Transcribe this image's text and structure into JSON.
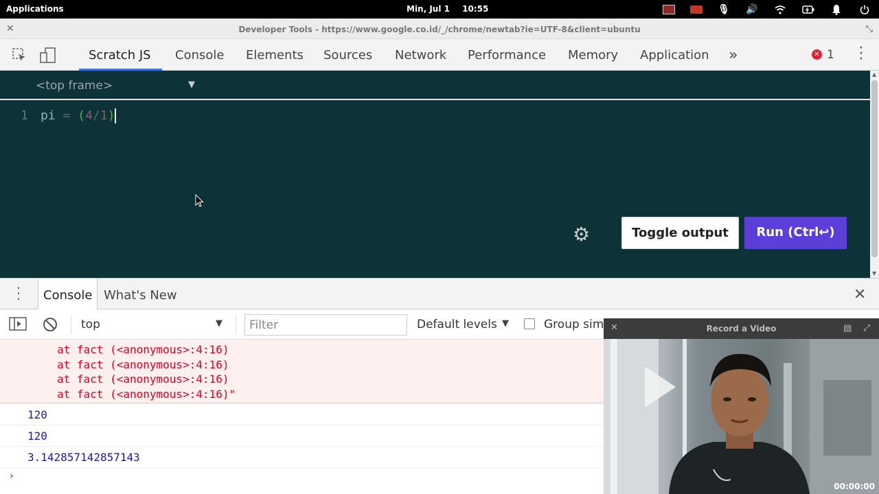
{
  "system_bar": {
    "applications": "Applications",
    "day_date": "Min, Jul 1",
    "time": "10:55"
  },
  "window": {
    "title": "Developer Tools - https://www.google.co.id/_/chrome/newtab?ie=UTF-8&client=ubuntu"
  },
  "devtools_tabs": [
    "Scratch JS",
    "Console",
    "Elements",
    "Sources",
    "Network",
    "Performance",
    "Memory",
    "Application"
  ],
  "more_tabs": "»",
  "error_badge": {
    "icon": "✕",
    "count": "1"
  },
  "editor": {
    "frame_selector": "<top frame>",
    "line_number": "1",
    "code": {
      "ident": "pi",
      "assign": "=",
      "open": "(",
      "num1": "4",
      "div": "/",
      "num2": "1",
      "close": ")"
    },
    "toggle_output": "Toggle output",
    "run": "Run (Ctrl↩)"
  },
  "drawer_tabs": {
    "console": "Console",
    "whats_new": "What's New"
  },
  "console_toolbar": {
    "context": "top",
    "filter_placeholder": "Filter",
    "levels": "Default levels",
    "group_similar": "Group sim"
  },
  "console_output": {
    "error_lines": [
      "at fact (<anonymous>:4:16)",
      "at fact (<anonymous>:4:16)",
      "at fact (<anonymous>:4:16)",
      "at fact (<anonymous>:4:16)\""
    ],
    "results": [
      "120",
      "120",
      "3.142857142857143"
    ],
    "prompt": "›"
  },
  "video_overlay": {
    "title": "Record a Video",
    "timer": "00:00:00"
  },
  "colors": {
    "editor_bg": "#0d3238",
    "run_button": "#5b3fd8",
    "error_text": "#e0001f",
    "result_text": "#1a1aa6",
    "active_tab": "#3b74dc"
  }
}
